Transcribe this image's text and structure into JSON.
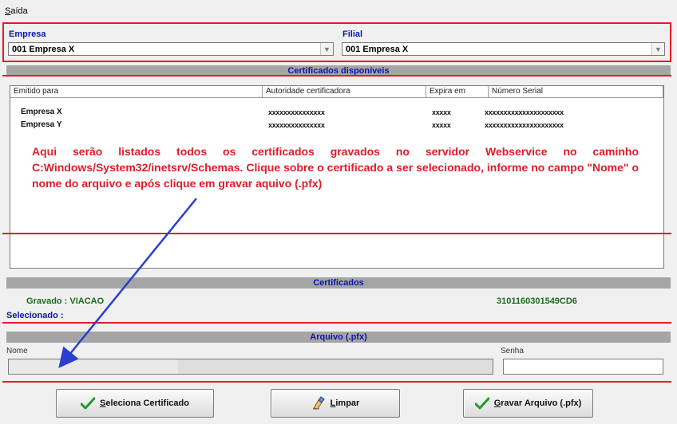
{
  "menu": {
    "exit_label": "Saída",
    "exit_mnemonic": "S",
    "exit_rest": "aída"
  },
  "company": {
    "empresa_label": "Empresa",
    "empresa_value": "001 Empresa X",
    "filial_label": "Filial",
    "filial_value": "001 Empresa X"
  },
  "certificates_available": {
    "section_title": "Certificados disponíveis",
    "columns": [
      "Emitido para",
      "Autoridade certificadora",
      "Expira em",
      "Número Serial"
    ],
    "rows": [
      {
        "issued_to": "Empresa X",
        "authority": "xxxxxxxxxxxxxxx",
        "expires": "xxxxx",
        "serial": "xxxxxxxxxxxxxxxxxxxxx"
      },
      {
        "issued_to": "Empresa Y",
        "authority": "xxxxxxxxxxxxxxx",
        "expires": "xxxxx",
        "serial": "xxxxxxxxxxxxxxxxxxxxx"
      }
    ]
  },
  "annotation_text": "Aqui serão listados todos os certificados gravados no servidor Webservice no caminho C:Windows/System32/inetsrv/Schemas. Clique sobre o certificado a ser selecionado, informe no campo \"Nome\" o nome do arquivo e após clique em gravar aquivo (.pfx)",
  "certificates": {
    "section_title": "Certificados",
    "saved_label": "Gravado : VIACAO",
    "saved_serial": "3101160301549CD6",
    "selected_label": "Selecionado :"
  },
  "file": {
    "section_title": "Arquivo (.pfx)",
    "name_label": "Nome",
    "name_value": "",
    "password_label": "Senha",
    "password_value": ""
  },
  "buttons": {
    "select_mnemonic": "S",
    "select_rest": "eleciona Certificado",
    "clear_mnemonic": "L",
    "clear_rest": "impar",
    "save_mnemonic": "G",
    "save_rest": "ravar Arquivo (.pfx)"
  },
  "colors": {
    "highlight_red": "#e01c2a",
    "label_blue": "#0b18a8",
    "check_green": "#1f9a2a",
    "arrow_blue": "#2a3fd0"
  },
  "icons": [
    "check-icon",
    "eraser-icon",
    "check-icon"
  ]
}
